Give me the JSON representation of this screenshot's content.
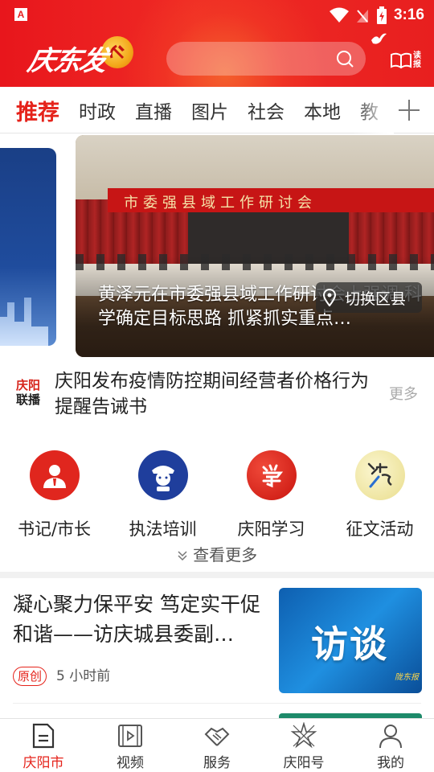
{
  "status_bar": {
    "time": "3:16"
  },
  "header": {
    "logo_text": "庆东发",
    "reader_label": "读报"
  },
  "tabs": [
    {
      "label": "推荐",
      "active": true
    },
    {
      "label": "时政",
      "active": false
    },
    {
      "label": "直播",
      "active": false
    },
    {
      "label": "图片",
      "active": false
    },
    {
      "label": "社会",
      "active": false
    },
    {
      "label": "本地",
      "active": false
    },
    {
      "label": "教",
      "active": false
    }
  ],
  "carousel": {
    "banner_text": "市委强县域工作研讨会",
    "title": "黄泽元在市委强县域工作研讨会上强调 科学确定目标思路 抓紧抓实重点…",
    "switch_region_label": "切换区县"
  },
  "ticker": {
    "badge_line1": "庆阳",
    "badge_line2": "联播",
    "text": "庆阳发布疫情防控期间经营者价格行为提醒告诫书",
    "more_label": "更多"
  },
  "entries": [
    {
      "label": "书记/市长",
      "icon": "official-avatar-icon"
    },
    {
      "label": "执法培训",
      "icon": "police-training-icon"
    },
    {
      "label": "庆阳学习",
      "icon": "study-icon"
    },
    {
      "label": "征文活动",
      "icon": "essay-contest-icon"
    }
  ],
  "see_more_label": "查看更多",
  "article": {
    "title": "凝心聚力保平安 笃定实干促和谐——访庆城县委副…",
    "tag": "原创",
    "time": "5 小时前",
    "thumb_text": "访谈",
    "thumb_mark": "陇东报"
  },
  "bottom_nav": [
    {
      "label": "庆阳市",
      "icon": "home-news-icon",
      "active": true
    },
    {
      "label": "视频",
      "icon": "video-icon",
      "active": false
    },
    {
      "label": "服务",
      "icon": "handshake-icon",
      "active": false
    },
    {
      "label": "庆阳号",
      "icon": "account-icon",
      "active": false
    },
    {
      "label": "我的",
      "icon": "profile-icon",
      "active": false
    }
  ],
  "colors": {
    "brand_red": "#e5231b",
    "header_red": "#e81f1f"
  }
}
